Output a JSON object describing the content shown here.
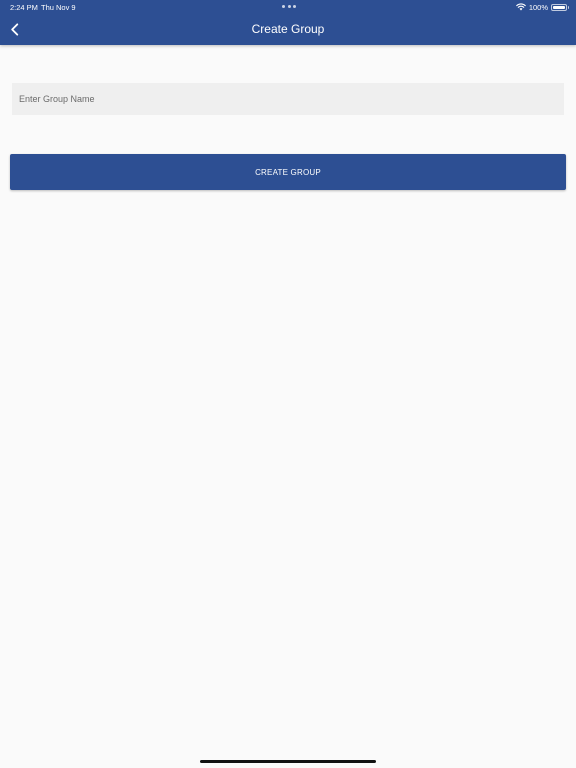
{
  "status_bar": {
    "time": "2:24 PM",
    "date": "Thu Nov 9",
    "battery": "100%",
    "wifi_icon": "wifi-icon",
    "battery_icon": "battery-icon"
  },
  "header": {
    "title": "Create Group",
    "back_icon": "chevron-left-icon"
  },
  "form": {
    "group_name": {
      "value": "",
      "placeholder": "Enter Group Name"
    },
    "create_label": "CREATE GROUP"
  },
  "colors": {
    "primary": "#2d4f93",
    "background": "#fafafa",
    "input_background": "#efefef"
  }
}
